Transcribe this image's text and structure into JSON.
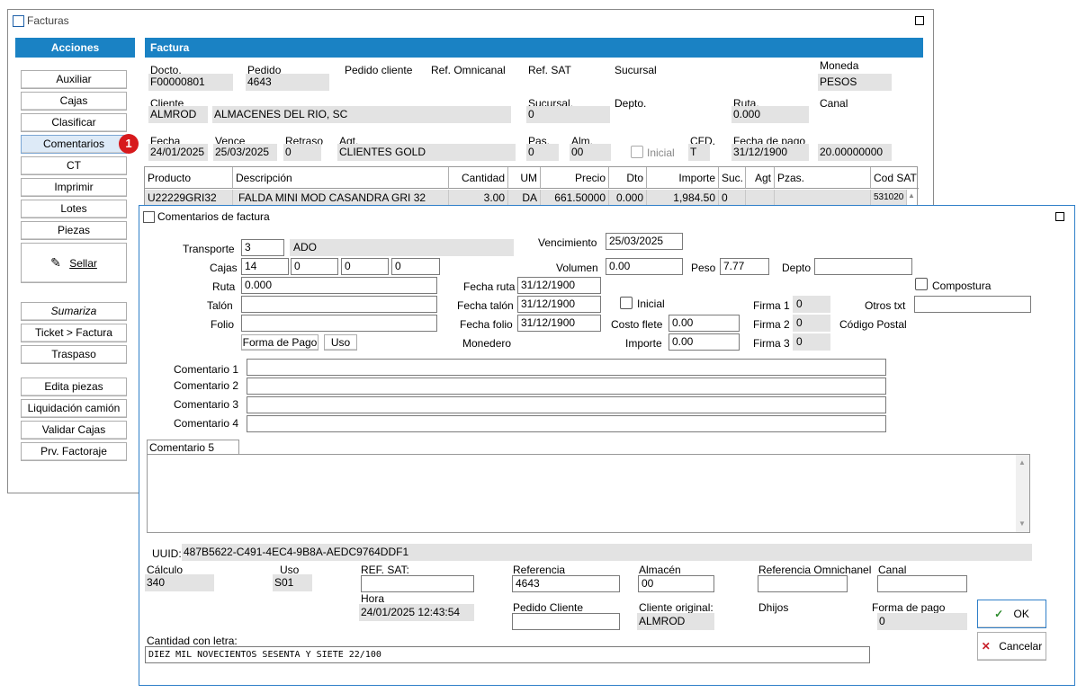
{
  "facturas": {
    "title": "Facturas",
    "acciones": "Acciones",
    "factura": "Factura",
    "buttons": [
      "Auxiliar",
      "Cajas",
      "Clasificar",
      "Comentarios",
      "CT",
      "Imprimir",
      "Lotes",
      "Piezas",
      "Sellar",
      "Sumariza",
      "Ticket > Factura",
      "Traspaso",
      "Edita piezas",
      "Liquidación camión",
      "Validar Cajas",
      "Prv. Factoraje"
    ],
    "badge": "1",
    "labels": {
      "docto": "Docto.",
      "pedido": "Pedido",
      "pedido_cliente": "Pedido cliente",
      "ref_omnicanal": "Ref. Omnicanal",
      "ref_sat": "Ref. SAT",
      "sucursal": "Sucursal",
      "moneda": "Moneda",
      "cliente": "Cliente",
      "sucursal2": "Sucursal.",
      "depto": "Depto.",
      "ruta": "Ruta.",
      "canal": "Canal",
      "fecha": "Fecha",
      "vence": "Vence",
      "retraso": "Retraso",
      "agt": "Agt.",
      "pas": "Pas.",
      "alm": "Alm.",
      "inicial": "Inicial",
      "cfd": "CFD.",
      "fecha_pago": "Fecha de pago"
    },
    "values": {
      "docto": "F00000801",
      "pedido": "4643",
      "moneda": "PESOS",
      "cliente_code": "ALMROD",
      "cliente_name": "ALMACENES DEL RIO, SC",
      "sucursal2": "0",
      "ruta": "0.000",
      "fecha": "24/01/2025",
      "vence": "25/03/2025",
      "retraso": "0",
      "agt": "CLIENTES GOLD",
      "pas": "0",
      "alm": "00",
      "cfd": "T",
      "fecha_pago": "31/12/1900",
      "tc": "20.00000000"
    },
    "grid": {
      "headers": [
        "Producto",
        "Descripción",
        "Cantidad",
        "UM",
        "Precio",
        "Dto",
        "Importe",
        "Suc.",
        "Agt",
        "Pzas.",
        "Cod SAT"
      ],
      "row": [
        "U22229GRI32",
        "FALDA MINI MOD CASANDRA GRI 32",
        "3.00",
        "DA",
        "661.50000",
        "0.000",
        "1,984.50",
        "0",
        "",
        "",
        "531020"
      ]
    }
  },
  "dialog": {
    "title": "Comentarios de factura",
    "labels": {
      "transporte": "Transporte",
      "cajas": "Cajas",
      "ruta": "Ruta",
      "talon": "Talón",
      "folio": "Folio",
      "forma_pago_btn": "Forma de Pago",
      "uso_btn": "Uso",
      "vencimiento": "Vencimiento",
      "volumen": "Volumen",
      "peso": "Peso",
      "depto": "Depto",
      "fecha_ruta": "Fecha ruta",
      "fecha_talon": "Fecha talón",
      "fecha_folio": "Fecha folio",
      "monedero": "Monedero",
      "inicial": "Inicial",
      "costo_flete": "Costo flete",
      "importe": "Importe",
      "firma1": "Firma 1",
      "firma2": "Firma 2",
      "firma3": "Firma 3",
      "compostura": "Compostura",
      "otros_txt": "Otros txt",
      "codigo_postal": "Código Postal",
      "comentario1": "Comentario 1",
      "comentario2": "Comentario 2",
      "comentario3": "Comentario 3",
      "comentario4": "Comentario 4",
      "comentario5": "Comentario 5",
      "uuid": "UUID:",
      "calculo": "Cálculo",
      "uso": "Uso",
      "ref_sat": "REF. SAT:",
      "referencia": "Referencia",
      "almacen": "Almacén",
      "ref_omni": "Referencia Omnichanel",
      "canal": "Canal",
      "hora": "Hora",
      "pedido_cliente": "Pedido Cliente",
      "cliente_original": "Cliente original:",
      "dhijos": "Dhijos",
      "forma_pago": "Forma de pago",
      "cantidad_letra": "Cantidad con letra:",
      "ok": "OK",
      "cancelar": "Cancelar"
    },
    "values": {
      "transporte": "3",
      "transporte_name": "ADO",
      "cajas": [
        "14",
        "0",
        "0",
        "0"
      ],
      "ruta": "0.000",
      "vencimiento": "25/03/2025",
      "volumen": "0.00",
      "peso": "7.77",
      "fecha_ruta": "31/12/1900",
      "fecha_talon": "31/12/1900",
      "fecha_folio": "31/12/1900",
      "costo_flete": "0.00",
      "importe": "0.00",
      "firma1": "0",
      "firma2": "0",
      "firma3": "0",
      "uuid": "487B5622-C491-4EC4-9B8A-AEDC9764DDF1",
      "calculo": "340",
      "uso": "S01",
      "referencia": "4643",
      "almacen": "00",
      "hora": "24/01/2025 12:43:54",
      "cliente_original": "ALMROD",
      "forma_pago": "0",
      "cantidad_letra": "DIEZ MIL NOVECIENTOS SESENTA Y SIETE 22/100"
    }
  }
}
